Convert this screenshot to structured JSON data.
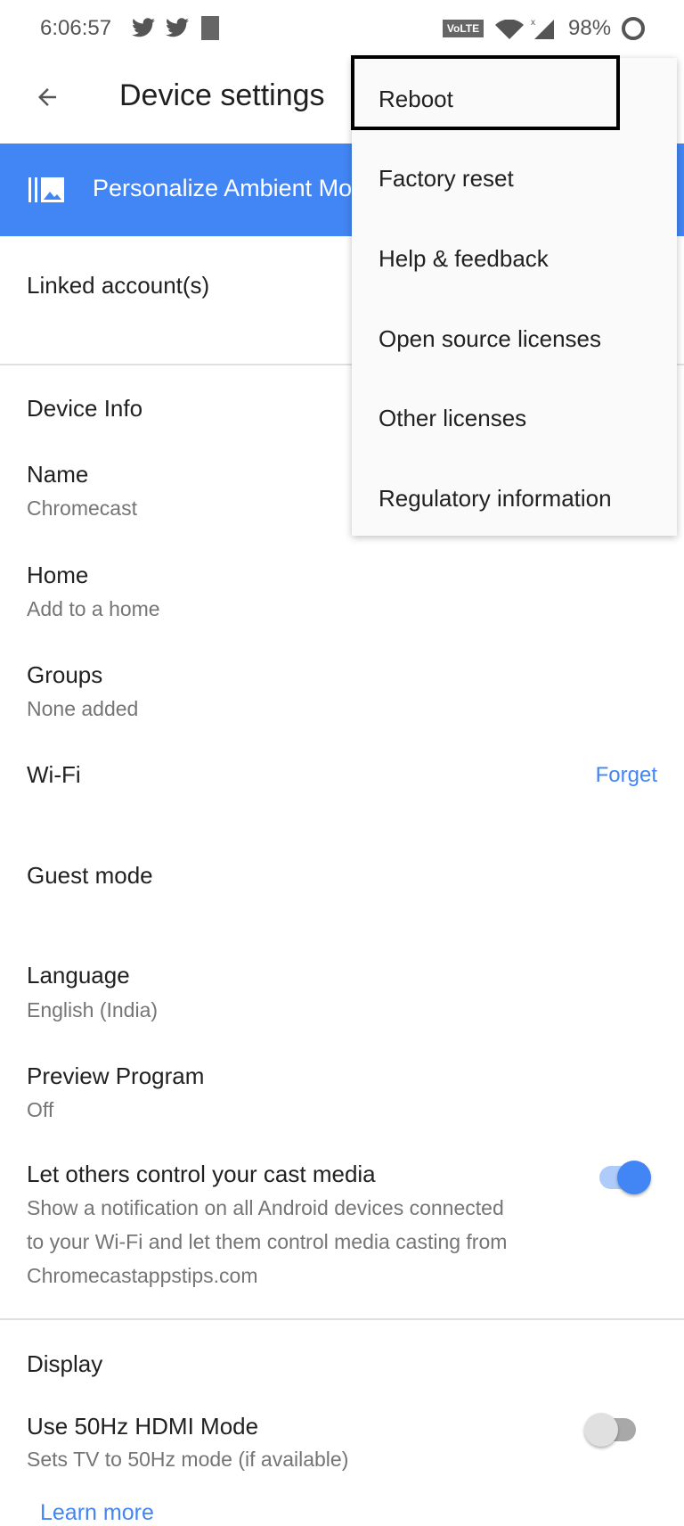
{
  "status_bar": {
    "time": "6:06:57",
    "battery": "98%",
    "network_badge": "VoLTE",
    "icons": [
      "twitter-icon",
      "twitter-icon",
      "notification-square-icon",
      "wifi-icon",
      "signal-icon",
      "battery-ring-icon"
    ]
  },
  "toolbar": {
    "title": "Device settings",
    "back_icon": "arrow-left-icon"
  },
  "banner": {
    "label": "Personalize Ambient Mode",
    "icon": "ambient-photo-icon",
    "color": "#4285f4"
  },
  "linked_accounts": {
    "label": "Linked account(s)"
  },
  "device_info": {
    "heading": "Device Info",
    "items": [
      {
        "label": "Name",
        "value": "Chromecast"
      },
      {
        "label": "Home",
        "value": "Add to a home"
      },
      {
        "label": "Groups",
        "value": "None added"
      },
      {
        "label": "Wi-Fi",
        "action": "Forget"
      },
      {
        "label": "Guest mode"
      },
      {
        "label": "Language",
        "value": "English (India)"
      },
      {
        "label": "Preview Program",
        "value": "Off"
      }
    ],
    "cast_control": {
      "label": "Let others control your cast media",
      "desc_lines": [
        "Show a notification on all Android devices connected",
        "to your Wi-Fi and let them control media casting from",
        "Chromecastappstips.com"
      ],
      "enabled": true
    }
  },
  "display": {
    "heading": "Display",
    "hdmi": {
      "label": "Use 50Hz HDMI Mode",
      "desc": "Sets TV to 50Hz mode (if available)",
      "enabled": false
    },
    "learn_more": "Learn more"
  },
  "menu": {
    "items": [
      "Reboot",
      "Factory reset",
      "Help & feedback",
      "Open source licenses",
      "Other licenses",
      "Regulatory information"
    ],
    "highlighted": "Reboot"
  },
  "colors": {
    "accent": "#4285f4",
    "toggle_track_on": "#aecbfa",
    "toggle_off_knob": "#e0e0e0"
  }
}
